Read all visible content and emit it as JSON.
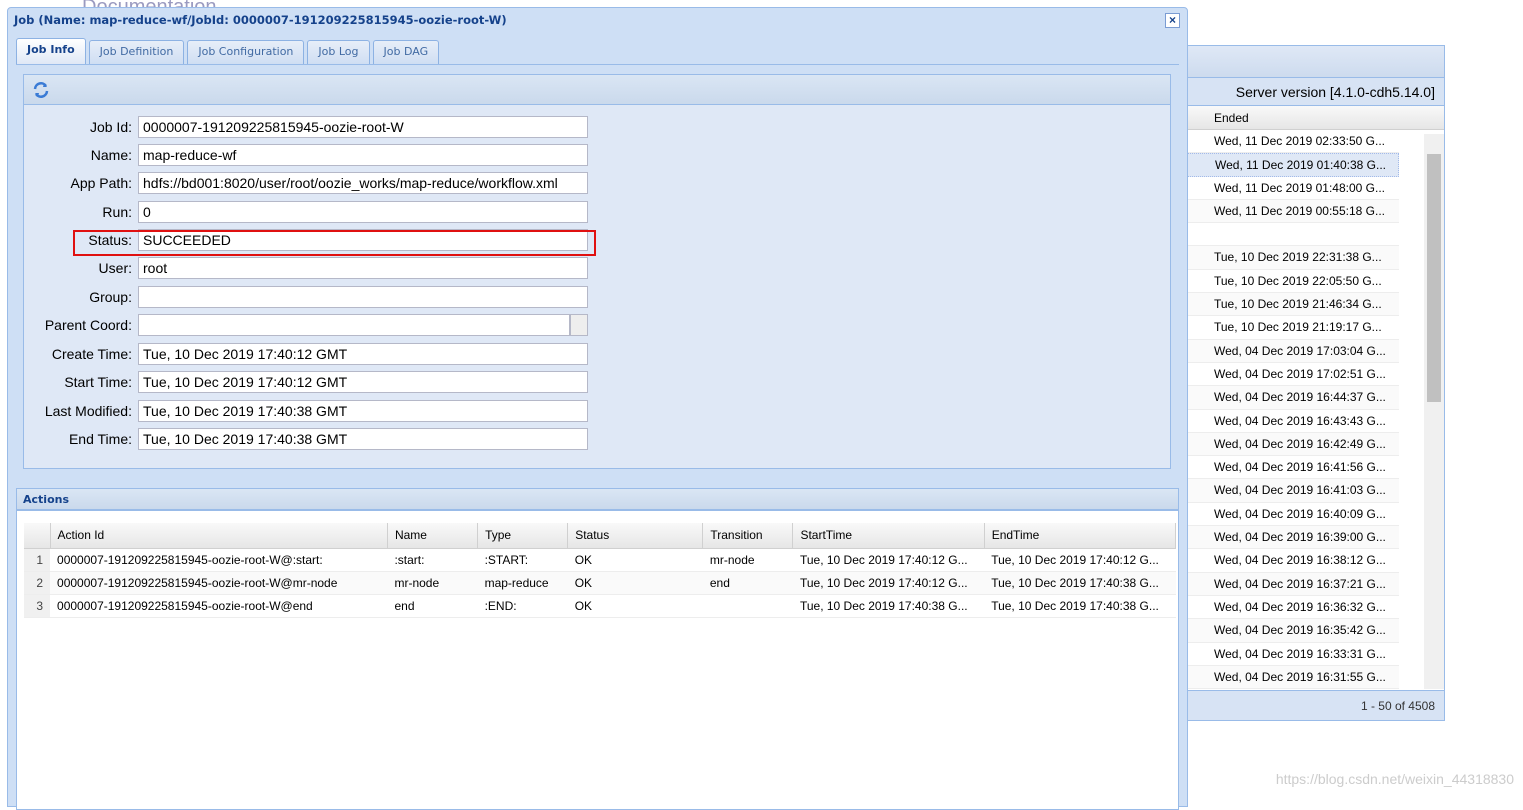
{
  "background": {
    "header_text": "Documentation",
    "server_version": "Server version [4.1.0-cdh5.14.0]",
    "column_ended": "Ended",
    "ended_rows": [
      "Wed, 11 Dec 2019 02:33:50 G...",
      "Wed, 11 Dec 2019 01:40:38 G...",
      "Wed, 11 Dec 2019 01:48:00 G...",
      "Wed, 11 Dec 2019 00:55:18 G...",
      "",
      "Tue, 10 Dec 2019 22:31:38 G...",
      "Tue, 10 Dec 2019 22:05:50 G...",
      "Tue, 10 Dec 2019 21:46:34 G...",
      "Tue, 10 Dec 2019 21:19:17 G...",
      "Wed, 04 Dec 2019 17:03:04 G...",
      "Wed, 04 Dec 2019 17:02:51 G...",
      "Wed, 04 Dec 2019 16:44:37 G...",
      "Wed, 04 Dec 2019 16:43:43 G...",
      "Wed, 04 Dec 2019 16:42:49 G...",
      "Wed, 04 Dec 2019 16:41:56 G...",
      "Wed, 04 Dec 2019 16:41:03 G...",
      "Wed, 04 Dec 2019 16:40:09 G...",
      "Wed, 04 Dec 2019 16:39:00 G...",
      "Wed, 04 Dec 2019 16:38:12 G...",
      "Wed, 04 Dec 2019 16:37:21 G...",
      "Wed, 04 Dec 2019 16:36:32 G...",
      "Wed, 04 Dec 2019 16:35:42 G...",
      "Wed, 04 Dec 2019 16:33:31 G...",
      "Wed, 04 Dec 2019 16:31:55 G..."
    ],
    "selected_row": 1,
    "pager": "1 - 50 of 4508"
  },
  "dialog": {
    "title": "Job (Name: map-reduce-wf/JobId: 0000007-191209225815945-oozie-root-W)",
    "close": "×",
    "tabs": [
      "Job Info",
      "Job Definition",
      "Job Configuration",
      "Job Log",
      "Job DAG"
    ],
    "active_tab": 0,
    "fields": [
      {
        "label": "Job Id:",
        "value": "0000007-191209225815945-oozie-root-W"
      },
      {
        "label": "Name:",
        "value": "map-reduce-wf"
      },
      {
        "label": "App Path:",
        "value": "hdfs://bd001:8020/user/root/oozie_works/map-reduce/workflow.xml"
      },
      {
        "label": "Run:",
        "value": "0"
      },
      {
        "label": "Status:",
        "value": "SUCCEEDED"
      },
      {
        "label": "User:",
        "value": "root"
      },
      {
        "label": "Group:",
        "value": ""
      },
      {
        "label": "Parent Coord:",
        "value": ""
      },
      {
        "label": "Create Time:",
        "value": "Tue, 10 Dec 2019 17:40:12 GMT"
      },
      {
        "label": "Start Time:",
        "value": "Tue, 10 Dec 2019 17:40:12 GMT"
      },
      {
        "label": "Last Modified:",
        "value": "Tue, 10 Dec 2019 17:40:38 GMT"
      },
      {
        "label": "End Time:",
        "value": "Tue, 10 Dec 2019 17:40:38 GMT"
      }
    ],
    "actions": {
      "title": "Actions",
      "columns": [
        "",
        "Action Id",
        "Name",
        "Type",
        "Status",
        "Transition",
        "StartTime",
        "EndTime"
      ],
      "rows": [
        [
          "1",
          "0000007-191209225815945-oozie-root-W@:start:",
          ":start:",
          ":START:",
          "OK",
          "mr-node",
          "Tue, 10 Dec 2019 17:40:12 G...",
          "Tue, 10 Dec 2019 17:40:12 G..."
        ],
        [
          "2",
          "0000007-191209225815945-oozie-root-W@mr-node",
          "mr-node",
          "map-reduce",
          "OK",
          "end",
          "Tue, 10 Dec 2019 17:40:12 G...",
          "Tue, 10 Dec 2019 17:40:38 G..."
        ],
        [
          "3",
          "0000007-191209225815945-oozie-root-W@end",
          "end",
          ":END:",
          "OK",
          "",
          "Tue, 10 Dec 2019 17:40:38 G...",
          "Tue, 10 Dec 2019 17:40:38 G..."
        ]
      ]
    }
  },
  "watermark": "https://blog.csdn.net/weixin_44318830",
  "colors": {
    "highlight": "#e01010",
    "title": "#15428b"
  }
}
